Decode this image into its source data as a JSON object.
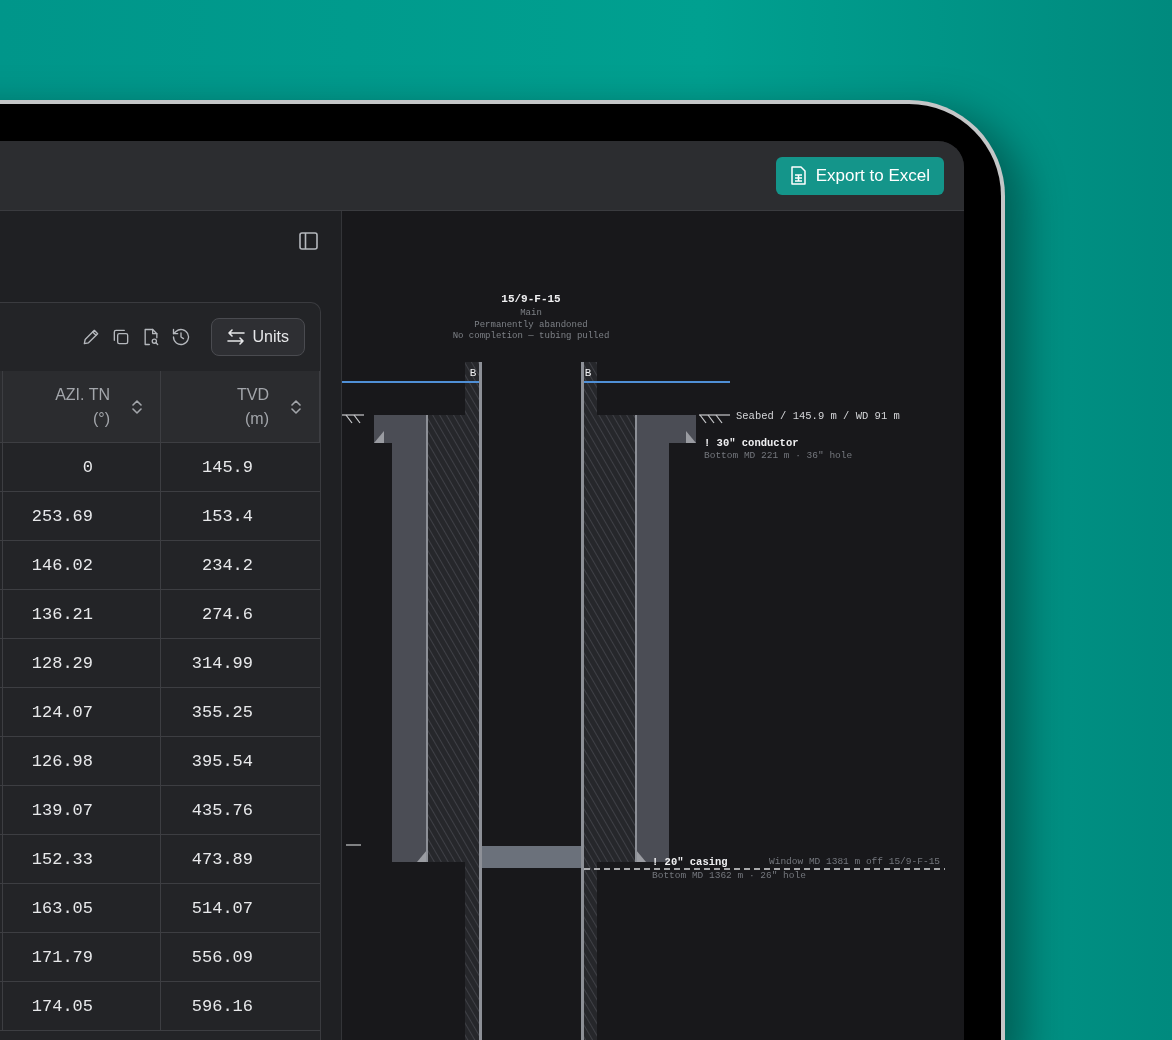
{
  "topbar": {
    "export_button": "Export to Excel"
  },
  "table": {
    "units_button": "Units",
    "columns": [
      {
        "title": "AZI. TN",
        "unit": "(°)"
      },
      {
        "title": "TVD",
        "unit": "(m)"
      }
    ],
    "rows": [
      [
        "0",
        "145.9"
      ],
      [
        "253.69",
        "153.4"
      ],
      [
        "146.02",
        "234.2"
      ],
      [
        "136.21",
        "274.6"
      ],
      [
        "128.29",
        "314.99"
      ],
      [
        "124.07",
        "355.25"
      ],
      [
        "126.98",
        "395.54"
      ],
      [
        "139.07",
        "435.76"
      ],
      [
        "152.33",
        "473.89"
      ],
      [
        "163.05",
        "514.07"
      ],
      [
        "171.79",
        "556.09"
      ],
      [
        "174.05",
        "596.16"
      ]
    ]
  },
  "diagram": {
    "well_name": "15/9-F-15",
    "subtitle": "Main",
    "status": "Permanently abandoned",
    "completion": "No completion — tubing pulled",
    "markers": [
      "B",
      "B"
    ],
    "seabed_label": "Seabed / 145.9 m / WD 91 m",
    "casings": [
      {
        "name": "! 30\" conductor",
        "detail": "Bottom MD 221 m · 36\" hole"
      },
      {
        "name": "! 20\" casing",
        "detail": "Bottom MD 1362 m · 26\" hole"
      }
    ],
    "window_label": "Window MD 1381 m off 15/9-F-15"
  }
}
